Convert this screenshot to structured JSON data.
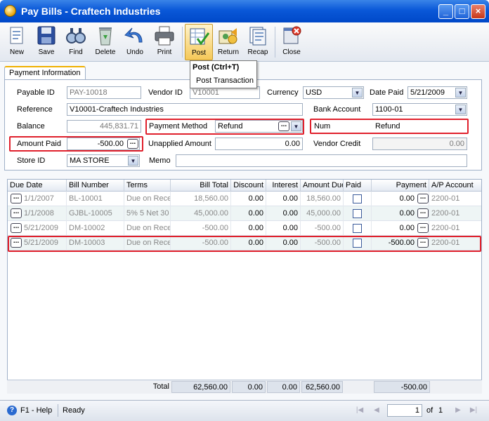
{
  "window": {
    "title": "Pay Bills - Craftech Industries"
  },
  "toolbar": {
    "buttons": [
      {
        "label": "New",
        "icon": "new-icon"
      },
      {
        "label": "Save",
        "icon": "save-icon"
      },
      {
        "label": "Find",
        "icon": "find-icon"
      },
      {
        "label": "Delete",
        "icon": "delete-icon"
      },
      {
        "label": "Undo",
        "icon": "undo-icon"
      },
      {
        "label": "Print",
        "icon": "print-icon"
      },
      {
        "label": "Post",
        "icon": "post-icon"
      },
      {
        "label": "Return",
        "icon": "return-icon"
      },
      {
        "label": "Recap",
        "icon": "recap-icon"
      },
      {
        "label": "Close",
        "icon": "close-icon"
      }
    ]
  },
  "tooltip": {
    "title": "Post (Ctrl+T)",
    "text": "Post Transaction"
  },
  "tabs": [
    {
      "label": "Payment Information"
    }
  ],
  "form": {
    "payable_id": {
      "label": "Payable ID",
      "value": "PAY-10018"
    },
    "vendor_id": {
      "label": "Vendor ID",
      "value": "V10001"
    },
    "currency": {
      "label": "Currency",
      "value": "USD"
    },
    "date_paid": {
      "label": "Date Paid",
      "value": "5/21/2009"
    },
    "reference": {
      "label": "Reference",
      "value": "V10001-Craftech Industries"
    },
    "bank_account": {
      "label": "Bank Account",
      "value": "1100-01"
    },
    "balance": {
      "label": "Balance",
      "value": "445,831.71"
    },
    "payment_method": {
      "label": "Payment Method",
      "value": "Refund"
    },
    "num": {
      "label": "Num",
      "value": "Refund"
    },
    "amount_paid": {
      "label": "Amount Paid",
      "value": "-500.00"
    },
    "unapplied_amount": {
      "label": "Unapplied Amount",
      "value": "0.00"
    },
    "vendor_credit": {
      "label": "Vendor Credit",
      "value": "0.00"
    },
    "store_id": {
      "label": "Store ID",
      "value": "MA STORE"
    },
    "memo": {
      "label": "Memo",
      "value": ""
    }
  },
  "grid": {
    "columns": [
      "Due Date",
      "Bill Number",
      "Terms",
      "Bill Total",
      "Discount",
      "Interest",
      "Amount Due",
      "Paid",
      "Payment",
      "A/P Account"
    ],
    "rows": [
      {
        "due_date": "1/1/2007",
        "bill_number": "BL-10001",
        "terms": "Due on Receipt",
        "bill_total": "18,560.00",
        "discount": "0.00",
        "interest": "0.00",
        "amount_due": "18,560.00",
        "paid": false,
        "payment": "0.00",
        "ap_account": "2200-01"
      },
      {
        "due_date": "1/1/2008",
        "bill_number": "GJBL-10005",
        "terms": "5% 5 Net 30",
        "bill_total": "45,000.00",
        "discount": "0.00",
        "interest": "0.00",
        "amount_due": "45,000.00",
        "paid": false,
        "payment": "0.00",
        "ap_account": "2200-01"
      },
      {
        "due_date": "5/21/2009",
        "bill_number": "DM-10002",
        "terms": "Due on Receipt",
        "bill_total": "-500.00",
        "discount": "0.00",
        "interest": "0.00",
        "amount_due": "-500.00",
        "paid": false,
        "payment": "0.00",
        "ap_account": "2200-01"
      },
      {
        "due_date": "5/21/2009",
        "bill_number": "DM-10003",
        "terms": "Due on Receipt",
        "bill_total": "-500.00",
        "discount": "0.00",
        "interest": "0.00",
        "amount_due": "-500.00",
        "paid": false,
        "payment": "-500.00",
        "ap_account": "2200-01"
      }
    ],
    "totals": {
      "label": "Total",
      "bill_total": "62,560.00",
      "discount": "0.00",
      "interest": "0.00",
      "amount_due": "62,560.00",
      "payment": "-500.00"
    }
  },
  "status": {
    "help": "F1 - Help",
    "state": "Ready",
    "page": "1",
    "of_label": "of",
    "total_pages": "1"
  },
  "colors": {
    "title_bar": "#0a58d8",
    "highlight_border": "#e0202c",
    "active_button": "#f5c858"
  }
}
